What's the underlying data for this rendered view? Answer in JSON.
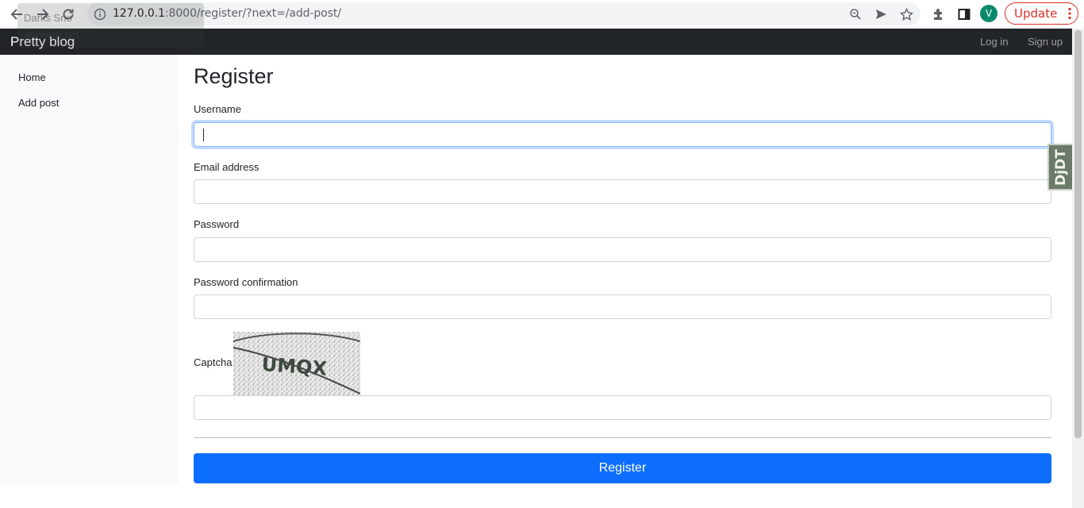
{
  "browser": {
    "url_host": "127.0.0.1",
    "url_rest": ":8000/register/?next=/add-post/",
    "avatar_letter": "V",
    "update_label": "Update",
    "tooltip_line1": "Darks Sno",
    "tooltip_line2": "ankiweb.net"
  },
  "site": {
    "brand": "Pretty blog",
    "nav": {
      "login": "Log in",
      "signup": "Sign up"
    }
  },
  "sidebar": {
    "items": [
      {
        "label": "Home"
      },
      {
        "label": "Add post"
      }
    ]
  },
  "form": {
    "title": "Register",
    "username_label": "Username",
    "username_value": "",
    "email_label": "Email address",
    "email_value": "",
    "password_label": "Password",
    "password_value": "",
    "password_confirm_label": "Password confirmation",
    "password_confirm_value": "",
    "captcha_label": "Captcha",
    "captcha_text": "UMQX",
    "captcha_value": "",
    "submit_label": "Register"
  },
  "debug_toolbar": {
    "handle_label": "DjDT"
  },
  "colors": {
    "navbar_bg": "#212529",
    "primary": "#0d6efd",
    "sidebar_bg": "#f8f9fa",
    "update_red": "#d93025"
  }
}
